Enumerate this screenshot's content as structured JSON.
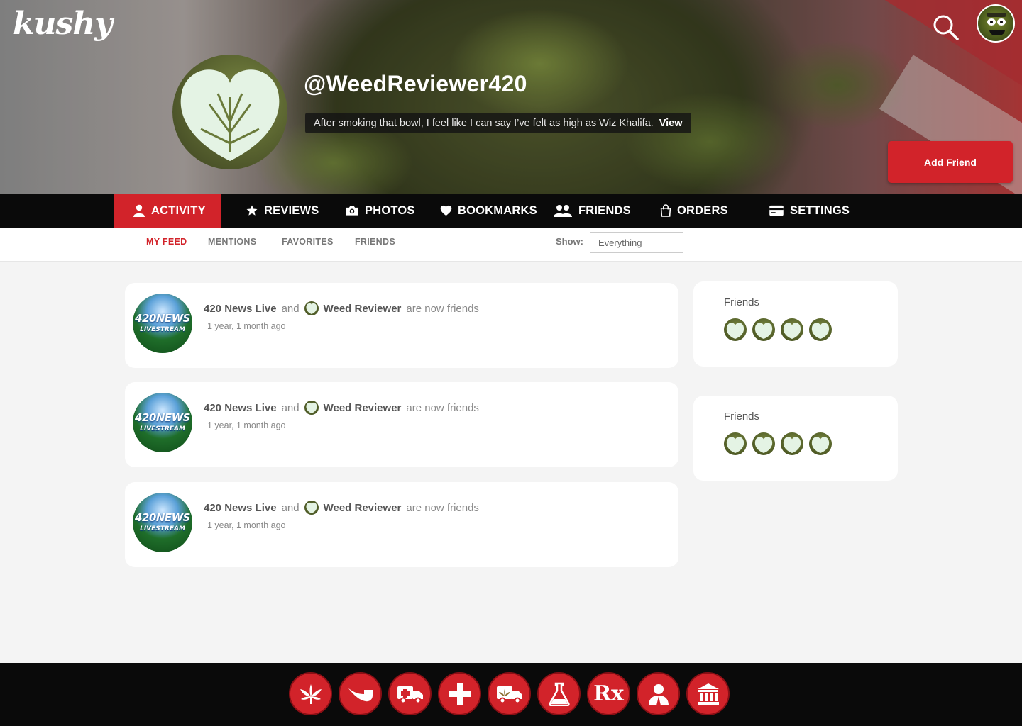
{
  "header": {
    "logo_text": "kushy",
    "search_icon": "search-icon",
    "user_avatar_icon": "user-avatar"
  },
  "profile": {
    "username": "@WeedReviewer420",
    "status": "After smoking that bowl, I feel like I can say I’ve felt as high as Wiz Khalifa.",
    "status_link": "View",
    "add_friend_label": "Add Friend"
  },
  "main_nav": {
    "items": [
      {
        "label": "ACTIVITY",
        "icon": "person-icon",
        "active": true
      },
      {
        "label": "REVIEWS",
        "icon": "star-icon"
      },
      {
        "label": "PHOTOS",
        "icon": "camera-icon"
      },
      {
        "label": "BOOKMARKS",
        "icon": "heart-icon"
      },
      {
        "label": "FRIENDS",
        "icon": "people-icon"
      },
      {
        "label": "ORDERS",
        "icon": "bag-icon"
      },
      {
        "label": "SETTINGS",
        "icon": "card-icon"
      }
    ]
  },
  "sub_nav": {
    "tabs": [
      {
        "label": "MY FEED",
        "active": true
      },
      {
        "label": "MENTIONS"
      },
      {
        "label": "FAVORITES"
      },
      {
        "label": "FRIENDS"
      }
    ],
    "show_label": "Show:",
    "show_value": "Everything"
  },
  "feed": {
    "items": [
      {
        "actor": "420 News Live",
        "connector": "and",
        "target": "Weed Reviewer",
        "action": "are now friends",
        "time": "1 year, 1 month ago",
        "avatar_text": "420NEWS",
        "avatar_subtext": "LIVESTREAM"
      },
      {
        "actor": "420 News Live",
        "connector": "and",
        "target": "Weed Reviewer",
        "action": "are now friends",
        "time": "1 year, 1 month ago",
        "avatar_text": "420NEWS",
        "avatar_subtext": "LIVESTREAM"
      },
      {
        "actor": "420 News Live",
        "connector": "and",
        "target": "Weed Reviewer",
        "action": "are now friends",
        "time": "1 year, 1 month ago",
        "avatar_text": "420NEWS",
        "avatar_subtext": "LIVESTREAM"
      }
    ]
  },
  "sidebar": {
    "cards": [
      {
        "title": "Friends",
        "friend_count_shown": 4
      },
      {
        "title": "Friends",
        "friend_count_shown": 4
      }
    ]
  },
  "footer": {
    "icons": [
      "leaf-icon",
      "pipe-icon",
      "ambulance-icon",
      "medical-cross-icon",
      "delivery-truck-icon",
      "flask-icon",
      "rx-icon",
      "doctor-icon",
      "bank-icon"
    ],
    "rx_text": "Rx"
  },
  "colors": {
    "accent": "#d2232a",
    "nav_bg": "#0a0a0a",
    "page_bg": "#f4f4f4"
  }
}
